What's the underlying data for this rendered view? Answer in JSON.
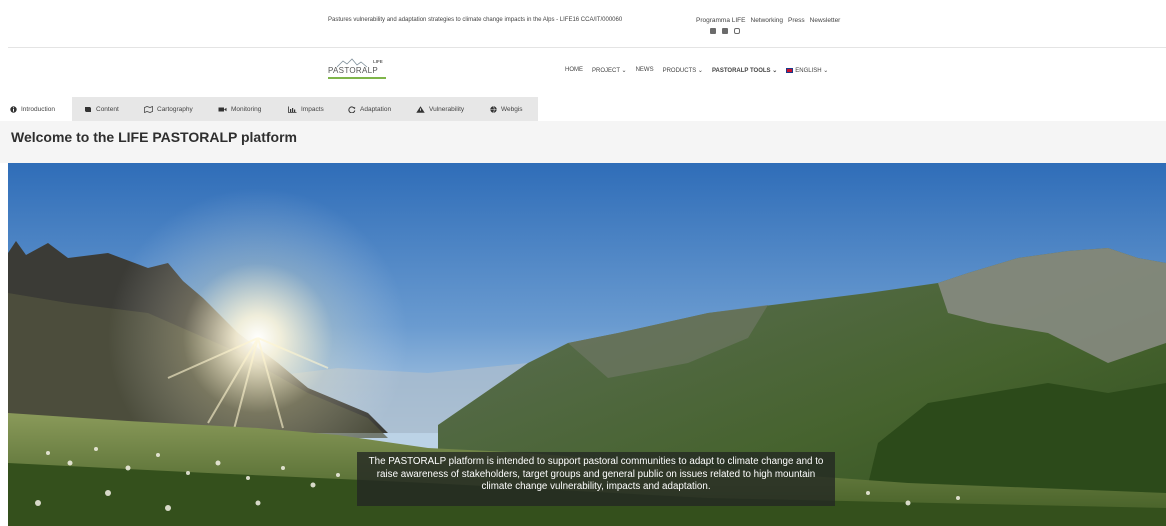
{
  "topbar": {
    "tagline": "Pastures vulnerability and adaptation strategies to climate change impacts in the Alps - LIFE16 CCA/IT/000060",
    "links": [
      "Programma LIFE",
      "Networking",
      "Press",
      "Newsletter"
    ],
    "social": [
      "facebook-icon",
      "youtube-icon",
      "instagram-icon"
    ]
  },
  "logo": {
    "wordmark": "PASTORALP",
    "life": "LIFE"
  },
  "nav": {
    "home": "HOME",
    "project": "PROJECT ⌄",
    "news": "NEWS",
    "products": "PRODUCTS ⌄",
    "tools": "PASTORALP TOOLS ⌄",
    "language": "ENGLISH ⌄"
  },
  "tabs": [
    {
      "label": "Introduction",
      "icon": "info-icon"
    },
    {
      "label": "Content",
      "icon": "book-icon"
    },
    {
      "label": "Cartography",
      "icon": "map-icon"
    },
    {
      "label": "Monitoring",
      "icon": "video-camera-icon"
    },
    {
      "label": "Impacts",
      "icon": "chart-icon"
    },
    {
      "label": "Adaptation",
      "icon": "refresh-icon"
    },
    {
      "label": "Vulnerability",
      "icon": "warning-icon"
    },
    {
      "label": "Webgis",
      "icon": "globe-icon"
    }
  ],
  "page": {
    "title": "Welcome to the LIFE PASTORALP platform"
  },
  "hero": {
    "caption": "The PASTORALP platform is intended to support pastoral communities to adapt to climate change and to raise awareness of stakeholders, target groups and general public on issues related to high mountain climate change vulnerability, impacts and adaptation."
  },
  "colors": {
    "accent_green": "#7fb54a",
    "tab_bg": "#e7e7e7",
    "sky": "#3f7cc4"
  }
}
